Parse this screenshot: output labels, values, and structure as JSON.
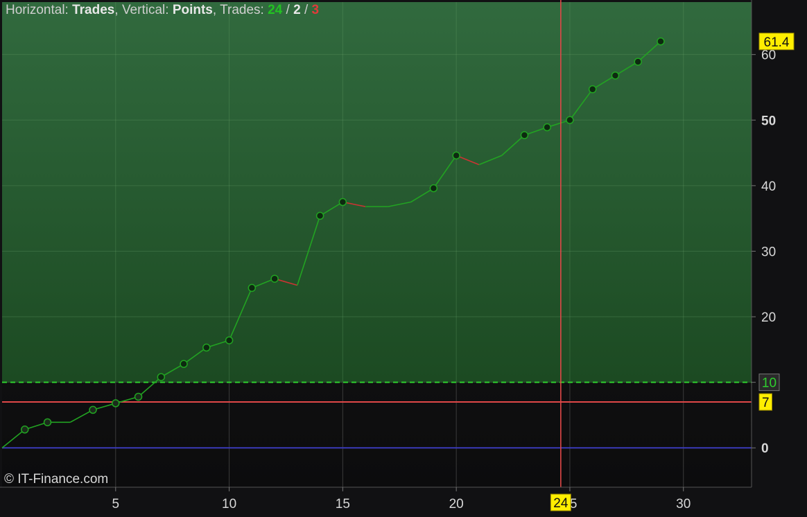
{
  "header": {
    "horizontal_label": "Horizontal:",
    "horizontal_value": "Trades",
    "vertical_label": "Vertical:",
    "vertical_value": "Points",
    "trades_label": "Trades:",
    "trades_total": "24",
    "trades_flat": "2",
    "trades_loss": "3",
    "sep1": ",",
    "sep2": ",",
    "slash": "/"
  },
  "copyright": "© IT-Finance.com",
  "colors": {
    "background": "#111113",
    "profit_zone_top": "#316a3e",
    "profit_zone_bottom": "#1c4a22",
    "line_up": "#22a322",
    "line_down": "#cc3333",
    "zero_line": "#3a3ab8",
    "target_line": "#2ed02e",
    "threshold_line": "#e04848",
    "crosshair": "#e04848",
    "label_bg": "#ffee00"
  },
  "chart_data": {
    "type": "line",
    "x_axis_label": "",
    "y_axis_label": "",
    "xlim": [
      0,
      33
    ],
    "ylim": [
      -6,
      68
    ],
    "x_ticks": [
      "5",
      "10",
      "15",
      "20",
      "25",
      "30"
    ],
    "x_tick_values": [
      5,
      10,
      15,
      20,
      25,
      30
    ],
    "y_ticks": [
      "0",
      "10",
      "20",
      "30",
      "40",
      "50",
      "60"
    ],
    "y_tick_values": [
      0,
      10,
      20,
      30,
      40,
      50,
      60
    ],
    "y_bold_ticks": [
      0,
      50
    ],
    "series": [
      {
        "x": [
          0,
          1,
          2,
          3,
          4,
          5,
          6,
          7,
          8,
          9,
          10,
          11,
          12,
          13,
          14,
          15,
          16,
          17,
          18,
          19,
          20,
          21,
          22,
          23,
          24,
          25,
          26,
          27,
          28,
          29
        ],
        "y": [
          0,
          2.8,
          3.9,
          3.9,
          5.8,
          6.8,
          7.8,
          10.8,
          12.8,
          15.3,
          16.4,
          24.4,
          25.8,
          24.8,
          35.4,
          37.5,
          36.8,
          36.8,
          37.5,
          39.6,
          44.6,
          43.2,
          44.6,
          47.7,
          48.9,
          50.0,
          54.7,
          56.8,
          58.9,
          62.0
        ],
        "markers": [
          false,
          true,
          true,
          false,
          true,
          true,
          true,
          true,
          true,
          true,
          true,
          true,
          true,
          false,
          true,
          true,
          false,
          false,
          false,
          true,
          true,
          false,
          false,
          true,
          true,
          true,
          true,
          true,
          true,
          true
        ]
      }
    ],
    "horizontal_lines": [
      {
        "value": 0,
        "label": "0",
        "style": "solid"
      },
      {
        "value": 10,
        "label": "10",
        "style": "dashed"
      },
      {
        "value": 7,
        "label": "7",
        "style": "solid"
      }
    ],
    "crosshair": {
      "x": 24.6,
      "x_label": "24"
    },
    "last_value_label": "61.4",
    "last_value": 62.0
  }
}
